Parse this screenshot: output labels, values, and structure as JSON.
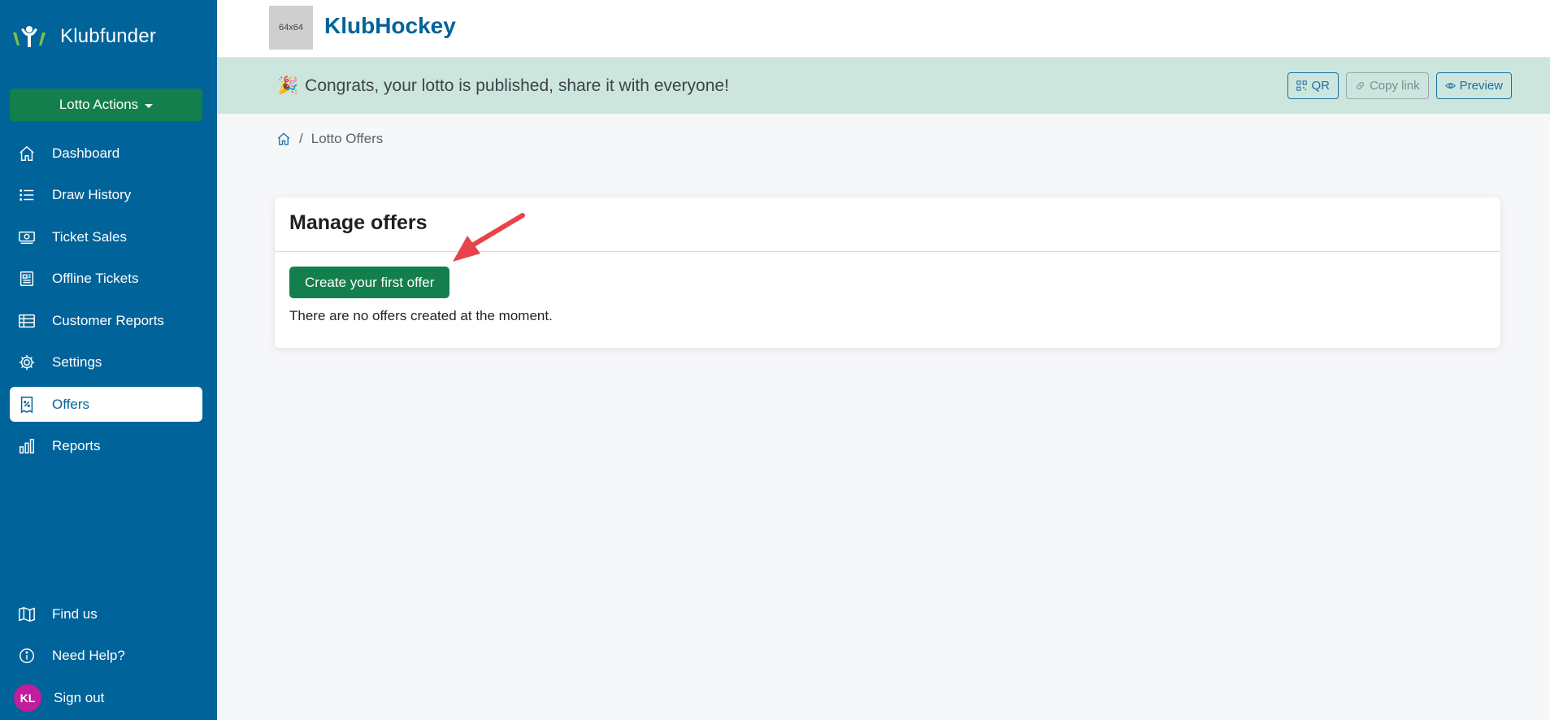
{
  "sidebar": {
    "brand": "Klubfunder",
    "actions_label": "Lotto Actions",
    "items": [
      {
        "label": "Dashboard",
        "icon": "home-icon"
      },
      {
        "label": "Draw History",
        "icon": "list-icon"
      },
      {
        "label": "Ticket Sales",
        "icon": "cash-icon"
      },
      {
        "label": "Offline Tickets",
        "icon": "newspaper-icon"
      },
      {
        "label": "Customer Reports",
        "icon": "table-icon"
      },
      {
        "label": "Settings",
        "icon": "gear-icon"
      },
      {
        "label": "Offers",
        "icon": "receipt-percent-icon",
        "active": true
      },
      {
        "label": "Reports",
        "icon": "bar-chart-icon"
      }
    ],
    "bottom": [
      {
        "label": "Find us",
        "icon": "map-icon"
      },
      {
        "label": "Need Help?",
        "icon": "info-icon"
      },
      {
        "label": "Sign out",
        "avatar": "KL"
      }
    ]
  },
  "header": {
    "logo_placeholder": "64x64",
    "club_name": "KlubHockey"
  },
  "banner": {
    "emoji": "🎉",
    "text": "Congrats, your lotto is published, share it with everyone!",
    "buttons": {
      "qr": "QR",
      "copy_link": "Copy link",
      "preview": "Preview"
    }
  },
  "breadcrumb": {
    "current": "Lotto Offers"
  },
  "card": {
    "title": "Manage offers",
    "create_label": "Create your first offer",
    "empty_text": "There are no offers created at the moment."
  },
  "colors": {
    "sidebar": "#00639a",
    "primary_green": "#137f4c",
    "banner_bg": "#cde6dd",
    "avatar": "#c01e9c",
    "annotation": "#e8434a"
  }
}
